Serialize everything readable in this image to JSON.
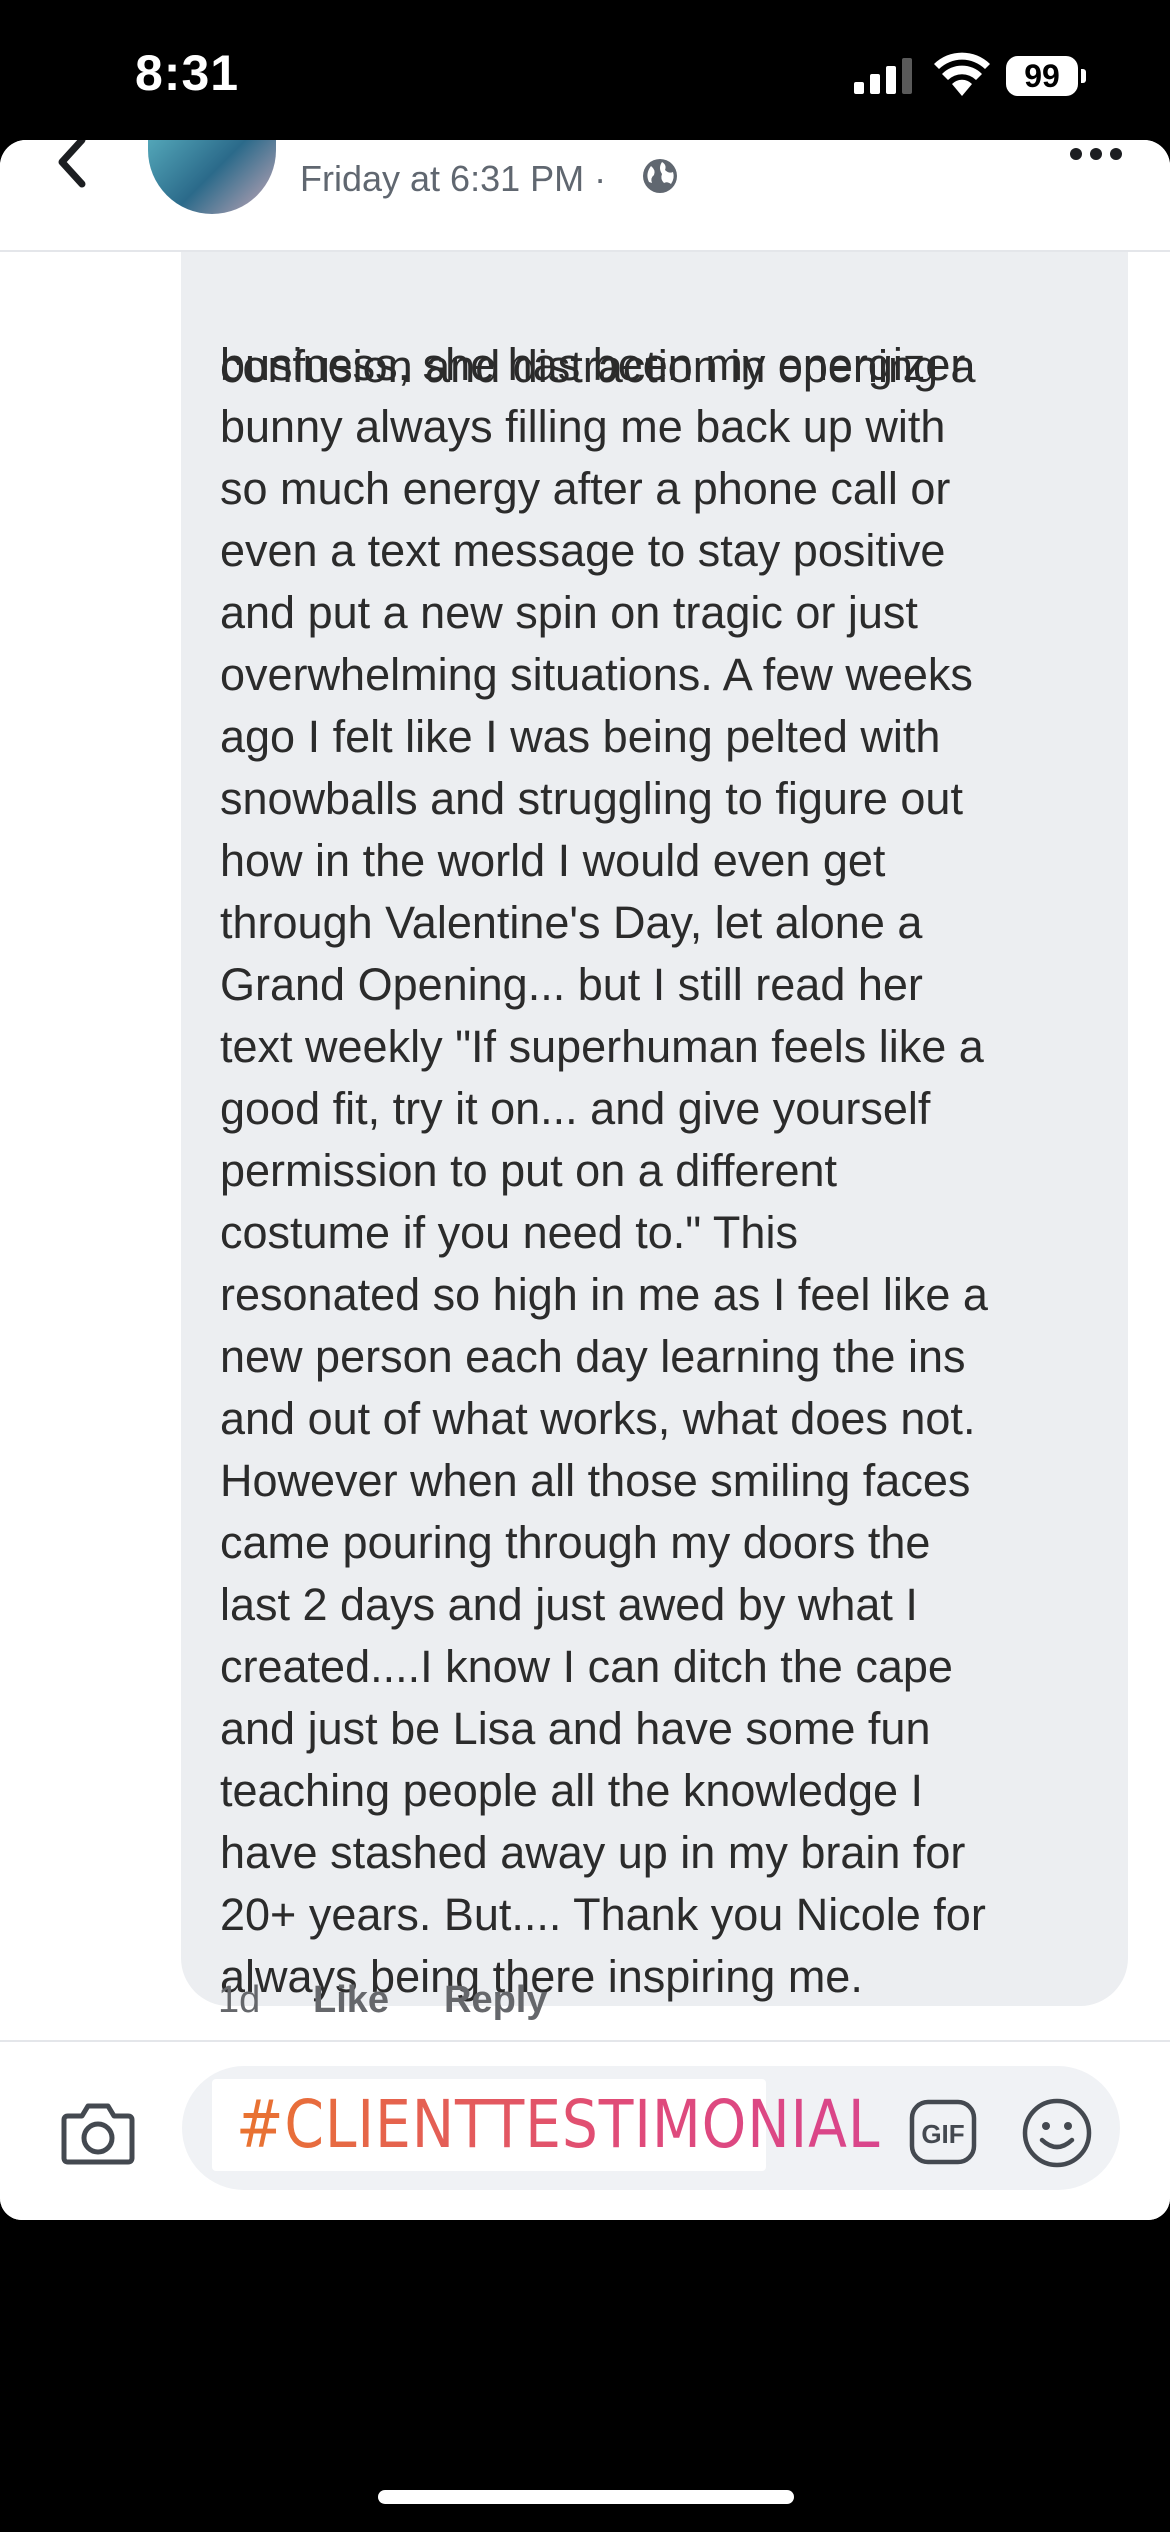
{
  "status_bar": {
    "time": "8:31",
    "battery": "99"
  },
  "header": {
    "post_time": "Friday at 6:31 PM ·"
  },
  "comment": {
    "clipped_top_line": "confusion and distraction in opening a",
    "text": "business, she has been my energizer\nbunny always filling me back up with\nso much energy after a phone call or\neven a text message to stay positive\nand put a new spin on tragic or just\noverwhelming situations. A few weeks\nago I felt like I was being pelted with\nsnowballs and struggling to figure out\nhow in the world I would even get\nthrough Valentine's Day, let alone a\nGrand Opening... but I still read her\ntext weekly \"If superhuman feels like a\ngood fit, try it on... and give yourself\npermission to put on a different\ncostume if you need to.\" This\nresonated so high in me as I feel like a\nnew person each day learning the ins\nand out of what works, what does not.\nHowever when all those smiling faces\ncame pouring through my doors the\nlast 2 days and just awed by what I\ncreated....I know I can ditch the cape\nand just be Lisa and have some fun\nteaching people all the knowledge I\nhave stashed away up in my brain for\n20+ years. But.... Thank you Nicole for\nalways being there inspiring me."
  },
  "actions": {
    "time_ago": "1d",
    "like": "Like",
    "reply": "Reply"
  },
  "composer": {
    "sticker_text": "#CLIENTTESTIMONIAL",
    "gif_label": "GIF"
  },
  "icons": {
    "back": "chevron-left-icon",
    "privacy": "globe-icon",
    "more": "more-dots-icon",
    "camera": "camera-icon",
    "gif": "gif-icon",
    "emoji": "smiley-icon"
  }
}
